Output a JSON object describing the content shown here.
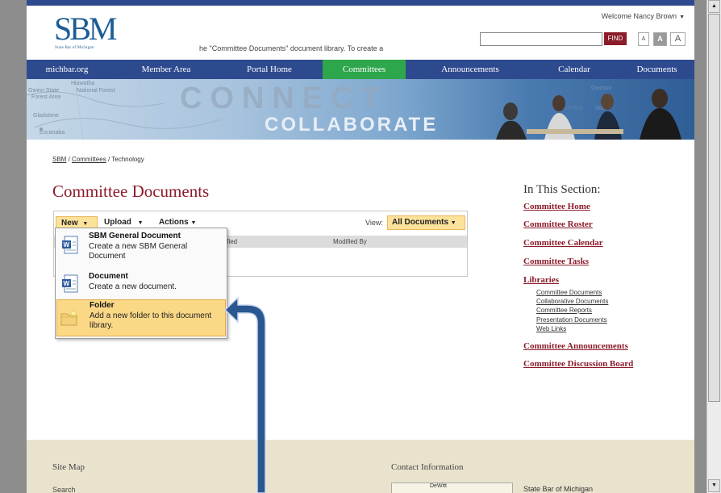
{
  "header": {
    "logo_text": "SBM",
    "logo_subtitle": "State Bar of Michigan",
    "welcome": "Welcome Nancy Brown",
    "search_value": "",
    "find_label": "FIND",
    "font_sizes": [
      "A",
      "A",
      "A"
    ]
  },
  "nav": {
    "items": [
      {
        "label": "michbar.org"
      },
      {
        "label": "Member Area"
      },
      {
        "label": "Portal Home"
      },
      {
        "label": "Committees",
        "active": true
      },
      {
        "label": "Announcements"
      },
      {
        "label": "Calendar"
      },
      {
        "label": "Documents"
      }
    ],
    "active_color": "#2ea64c",
    "bar_color": "#2e4a8f"
  },
  "banner": {
    "word1": "CONNECT",
    "word2": "COLLABORATE",
    "map_labels": [
      "Hiawatha",
      "National Forest",
      "Gwinn State",
      "Forest Area",
      "Gladstone",
      "Escanaba",
      "Lansing",
      "Owosso",
      "Wate"
    ]
  },
  "breadcrumb": {
    "home": "SBM",
    "committees": "Committees",
    "current": "Technology"
  },
  "main": {
    "title": "Committee Documents"
  },
  "library": {
    "toolbar": {
      "new_label": "New",
      "upload_label": "Upload",
      "actions_label": "Actions",
      "view_label": "View:",
      "view_value": "All Documents"
    },
    "columns": {
      "modified": "dified",
      "modified_by": "Modified By"
    },
    "empty_text": "he \"Committee Documents\" document library. To create a"
  },
  "new_menu": {
    "items": [
      {
        "title": "SBM General Document",
        "description": "Create a new SBM General Document",
        "icon": "word-document-icon"
      },
      {
        "title": "Document",
        "description": "Create a new document.",
        "icon": "word-document-icon"
      },
      {
        "title": "Folder",
        "description": "Add a new folder to this document library.",
        "icon": "folder-icon",
        "highlighted": true
      }
    ]
  },
  "sidebar": {
    "title": "In This Section:",
    "links": [
      "Committee Home",
      "Committee Roster",
      "Committee Calendar",
      "Committee Tasks",
      "Libraries"
    ],
    "library_links": [
      "Committee Documents",
      "Collaborative Documents",
      "Committee Reports",
      "Presentation Documents",
      "Web Links"
    ],
    "links_after": [
      "Committee Announcements",
      "Committee Discussion Board"
    ]
  },
  "footer": {
    "sitemap_label": "Site Map",
    "search_label": "Search",
    "contact_label": "Contact Information",
    "map_city": "DeWitt",
    "org_name": "State Bar of Michigan"
  },
  "colors": {
    "accent": "#8b1c2a",
    "highlight": "#fbd886",
    "arrow": "#2b5790"
  }
}
